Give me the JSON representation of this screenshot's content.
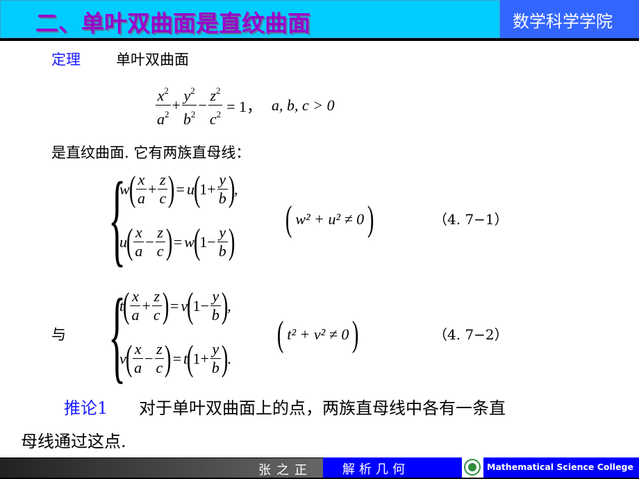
{
  "header": {
    "title": "二、单叶双曲面是直纹曲面",
    "college": "数学科学学院"
  },
  "theorem": {
    "label": "定理",
    "subject": "单叶双曲面",
    "equation_terms": {
      "x_num": "x",
      "a_den": "a",
      "y_num": "y",
      "b_den": "b",
      "z_num": "z",
      "c_den": "c",
      "sq": "2",
      "plus": "+",
      "minus": "−",
      "eq_rhs": "= 1，",
      "cond": "a, b, c > 0"
    },
    "statement": "是直纹曲面. 它有两族直母线："
  },
  "family1": {
    "line1": {
      "lhs_coef": "w",
      "op": "+",
      "rhs_coef": "u",
      "rhs_op": "+",
      "tail": ","
    },
    "line2": {
      "lhs_coef": "u",
      "op": "−",
      "rhs_coef": "w",
      "rhs_op": "−",
      "tail": ""
    },
    "condition": "w² + u² ≠ 0",
    "number": "（4. 7−1）"
  },
  "connector": "与",
  "family2": {
    "line1": {
      "lhs_coef": "t",
      "op": "+",
      "rhs_coef": "v",
      "rhs_op": "−",
      "tail": ","
    },
    "line2": {
      "lhs_coef": "v",
      "op": "−",
      "rhs_coef": "t",
      "rhs_op": "+",
      "tail": "."
    },
    "condition": "t² + v² ≠ 0",
    "number": "（4. 7−2）"
  },
  "corollary": {
    "label": "推论1",
    "text1": "对于单叶双曲面上的点，两族直母线中各有一条直",
    "text2": "母线通过这点."
  },
  "footer": {
    "author": "张之正",
    "course": "解析几何",
    "college_en": "Mathematical Science College"
  },
  "colors": {
    "title_bar": "#00ccff",
    "title_text": "#9900cc",
    "college_box": "#3366ff",
    "label_blue": "#1a1aff",
    "footer_blue": "#0000ff"
  }
}
